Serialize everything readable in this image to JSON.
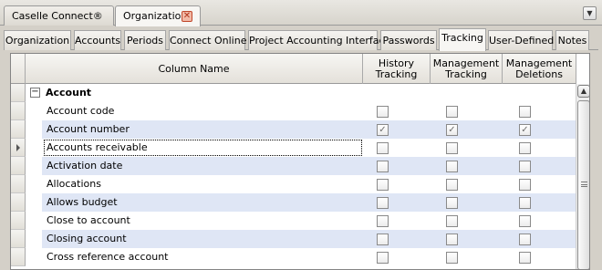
{
  "document_tabs": [
    {
      "label": "Caselle Connect®",
      "active": false
    },
    {
      "label": "Organization",
      "active": true,
      "closable": true
    }
  ],
  "tab_menu_icon": "chevron-down-icon",
  "sub_tabs": [
    {
      "label": "Organization",
      "active": false
    },
    {
      "label": "Accounts",
      "active": false
    },
    {
      "label": "Periods",
      "active": false
    },
    {
      "label": "Connect Online",
      "active": false
    },
    {
      "label": "Project Accounting Interface",
      "active": false
    },
    {
      "label": "Passwords",
      "active": false
    },
    {
      "label": "Tracking",
      "active": true
    },
    {
      "label": "User-Defined",
      "active": false
    },
    {
      "label": "Notes",
      "active": false
    }
  ],
  "grid": {
    "columns": {
      "column_name": "Column Name",
      "history": "History\nTracking",
      "management": "Management\nTracking",
      "deletions": "Management\nDeletions"
    },
    "group": {
      "label": "Account",
      "expanded": true,
      "expander_glyph": "−"
    },
    "rows": [
      {
        "name": "Account code",
        "history": false,
        "management": false,
        "deletions": false
      },
      {
        "name": "Account number",
        "history": true,
        "management": true,
        "deletions": true
      },
      {
        "name": "Accounts receivable",
        "history": false,
        "management": false,
        "deletions": false,
        "current": true
      },
      {
        "name": "Activation date",
        "history": false,
        "management": false,
        "deletions": false
      },
      {
        "name": "Allocations",
        "history": false,
        "management": false,
        "deletions": false
      },
      {
        "name": "Allows budget",
        "history": false,
        "management": false,
        "deletions": false
      },
      {
        "name": "Close to account",
        "history": false,
        "management": false,
        "deletions": false
      },
      {
        "name": "Closing account",
        "history": false,
        "management": false,
        "deletions": false
      },
      {
        "name": "Cross reference account",
        "history": false,
        "management": false,
        "deletions": false
      }
    ]
  },
  "colors": {
    "alt_row": "#dfe6f5",
    "window_bg": "#d4d0c8",
    "close_icon": "#c0472b"
  }
}
